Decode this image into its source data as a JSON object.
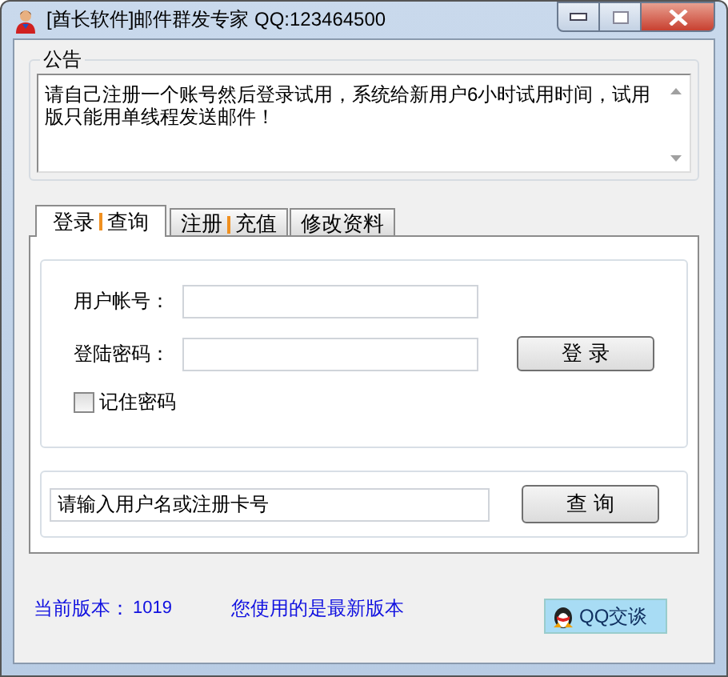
{
  "window": {
    "title": "[酋长软件]邮件群发专家 QQ:123464500"
  },
  "notice": {
    "label": "公告",
    "text": "请自己注册一个账号然后登录试用，系统给新用户6小时试用时间，试用版只能用单线程发送邮件！"
  },
  "tabs": [
    {
      "parts": [
        "登录",
        "查询"
      ],
      "selected": true
    },
    {
      "parts": [
        "注册",
        "充值"
      ],
      "selected": false
    },
    {
      "parts": [
        "修改资料"
      ],
      "selected": false
    }
  ],
  "login": {
    "account_label": "用户帐号：",
    "password_label": "登陆密码：",
    "login_button": "登 录",
    "remember": {
      "label": "记住密码",
      "checked": false
    }
  },
  "query": {
    "value": "请输入用户名或注册卡号",
    "button": "查 询"
  },
  "footer": {
    "version_label": "当前版本：",
    "version": "1019",
    "message": "您使用的是最新版本",
    "qq_button": "QQ交谈"
  }
}
